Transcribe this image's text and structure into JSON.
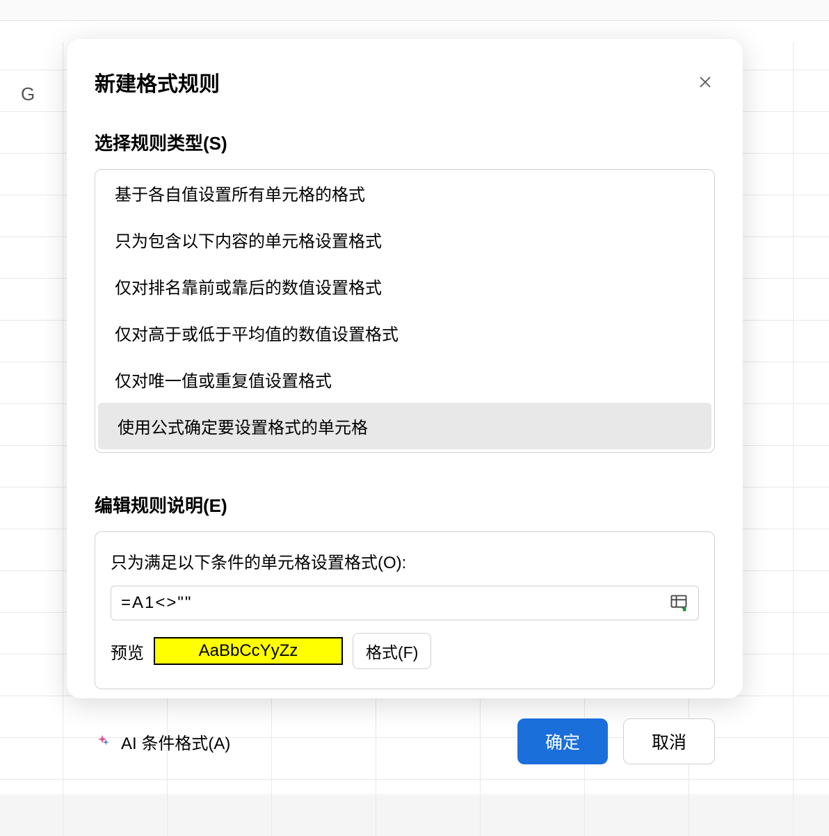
{
  "spreadsheet": {
    "column_header": "G"
  },
  "dialog": {
    "title": "新建格式规则",
    "section_rule_type": "选择规则类型(S)",
    "rule_types": [
      "基于各自值设置所有单元格的格式",
      "只为包含以下内容的单元格设置格式",
      "仅对排名靠前或靠后的数值设置格式",
      "仅对高于或低于平均值的数值设置格式",
      "仅对唯一值或重复值设置格式",
      "使用公式确定要设置格式的单元格"
    ],
    "selected_rule_index": 5,
    "section_edit": "编辑规则说明(E)",
    "edit_label": "只为满足以下条件的单元格设置格式(O):",
    "formula_value": "=A1<>\"\"",
    "preview_label": "预览",
    "preview_sample": "AaBbCcYyZz",
    "format_button": "格式(F)",
    "ai_link": "AI 条件格式(A)",
    "ok_button": "确定",
    "cancel_button": "取消"
  }
}
